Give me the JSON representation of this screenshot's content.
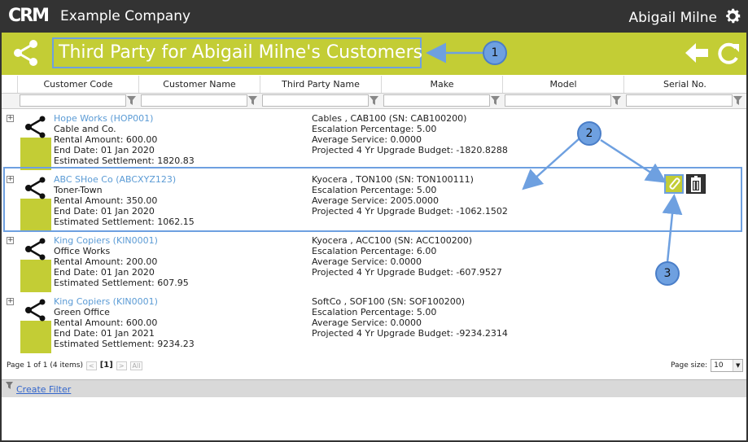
{
  "app": {
    "logo_text": "CRM",
    "company": "Example Company",
    "user": "Abigail Milne"
  },
  "header": {
    "title": "Third Party for Abigail Milne's Customers",
    "accent_color": "#c3cd35"
  },
  "columns": [
    "Customer Code",
    "Customer Name",
    "Third Party Name",
    "Make",
    "Model",
    "Serial No."
  ],
  "rows": [
    {
      "customer_link": "Hope Works (HOP001)",
      "name": "Cable and Co.",
      "rental": "Rental Amount: 600.00",
      "end_date": "End Date: 01 Jan 2020",
      "settlement": "Estimated Settlement: 1820.83",
      "product": "Cables , CAB100 (SN: CAB100200)",
      "escalation": "Escalation Percentage: 5.00",
      "avg_service": "Average Service: 0.0000",
      "budget": "Projected 4 Yr Upgrade Budget: -1820.8288"
    },
    {
      "customer_link": "ABC SHoe Co (ABCXYZ123)",
      "name": "Toner-Town",
      "rental": "Rental Amount: 350.00",
      "end_date": "End Date: 01 Jan 2020",
      "settlement": "Estimated Settlement: 1062.15",
      "product": "Kyocera , TON100 (SN: TON100111)",
      "escalation": "Escalation Percentage: 5.00",
      "avg_service": "Average Service: 2005.0000",
      "budget": "Projected 4 Yr Upgrade Budget: -1062.1502"
    },
    {
      "customer_link": "King Copiers (KIN0001)",
      "name": "Office Works",
      "rental": "Rental Amount: 200.00",
      "end_date": "End Date: 01 Jan 2020",
      "settlement": "Estimated Settlement: 607.95",
      "product": "Kyocera , ACC100 (SN: ACC100200)",
      "escalation": "Escalation Percentage: 6.00",
      "avg_service": "Average Service: 0.0000",
      "budget": "Projected 4 Yr Upgrade Budget: -607.9527"
    },
    {
      "customer_link": "King Copiers (KIN0001)",
      "name": "Green Office",
      "rental": "Rental Amount: 600.00",
      "end_date": "End Date: 01 Jan 2021",
      "settlement": "Estimated Settlement: 9234.23",
      "product": "SoftCo , SOF100 (SN: SOF100200)",
      "escalation": "Escalation Percentage: 5.00",
      "avg_service": "Average Service: 0.0000",
      "budget": "Projected 4 Yr Upgrade Budget: -9234.2314"
    }
  ],
  "pager": {
    "summary": "Page 1 of 1 (4 items)",
    "prev": "<",
    "current": "[1]",
    "next": ">",
    "all": "All",
    "page_size_label": "Page size:",
    "page_size_value": "10"
  },
  "filter": {
    "create_label": "Create Filter"
  },
  "callouts": [
    "1",
    "2",
    "3"
  ],
  "icons": {
    "share": "share-icon",
    "back": "back-arrow-icon",
    "refresh": "refresh-icon",
    "settings": "gear-icon",
    "edit": "pencil-icon",
    "delete": "trash-icon",
    "filter": "funnel-icon"
  }
}
